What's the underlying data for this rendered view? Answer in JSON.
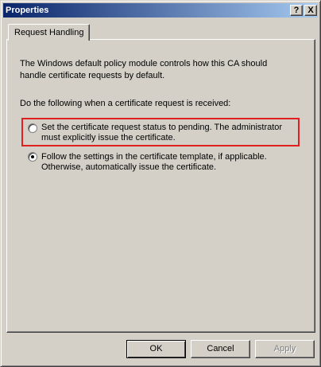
{
  "window": {
    "title": "Properties",
    "help_label": "?",
    "close_label": "X"
  },
  "tabs": [
    {
      "label": "Request Handling",
      "selected": true
    }
  ],
  "content": {
    "description": "The Windows default policy module controls how this CA should handle certificate requests by default.",
    "prompt": "Do the following when a certificate request is received:",
    "options": [
      {
        "label": "Set the certificate request status to pending. The administrator must explicitly issue the certificate.",
        "selected": false,
        "highlighted": true
      },
      {
        "label": "Follow the settings in the certificate template, if applicable. Otherwise, automatically issue the certificate.",
        "selected": true,
        "highlighted": false
      }
    ]
  },
  "buttons": {
    "ok": "OK",
    "cancel": "Cancel",
    "apply": "Apply"
  },
  "colors": {
    "title_gradient_start": "#0a246a",
    "title_gradient_end": "#a6caf0",
    "face": "#d4d0c8",
    "highlight_box": "#e02020"
  }
}
